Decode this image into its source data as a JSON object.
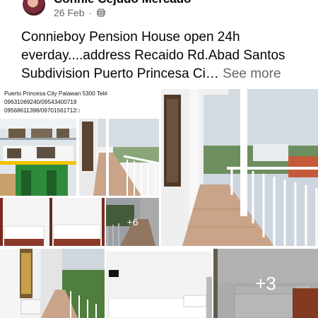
{
  "post": {
    "author_name": "Connie Cejudo Mercado",
    "date": "26 Feb",
    "separator": "·",
    "privacy_icon": "globe-icon",
    "text_lines": [
      "Connieboy Pension House open 24h",
      "everday....address Recaido Rd.Abad Santos",
      "Subdivision Puerto Princesa Ci…"
    ],
    "see_more": "See more"
  },
  "gallery": {
    "caption_lines": [
      "Puerto Princesa City Palawan 5300 Tel#",
      "09631069240/09543400719",
      "09568611398/09701561712□"
    ],
    "more_count_1": "+6",
    "more_count_2": "+3"
  },
  "colors": {
    "text": "#050505",
    "secondary": "#65676b",
    "building_green": "#2e8b3a",
    "accent_yellow": "#f2c200",
    "tile": "#c9a488"
  }
}
